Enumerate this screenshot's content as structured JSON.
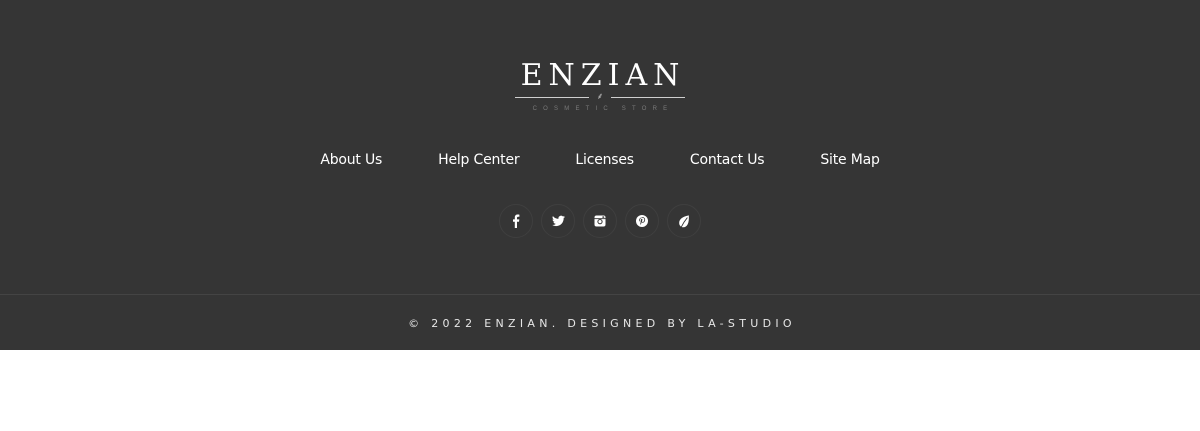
{
  "logo": {
    "name": "ENZIAN",
    "tagline": "COSMETIC STORE"
  },
  "nav": {
    "items": [
      {
        "label": "About Us"
      },
      {
        "label": "Help Center"
      },
      {
        "label": "Licenses"
      },
      {
        "label": "Contact Us"
      },
      {
        "label": "Site Map"
      }
    ]
  },
  "social": {
    "icons": [
      "facebook-icon",
      "twitter-icon",
      "instagram-icon",
      "pinterest-icon",
      "leaf-icon"
    ]
  },
  "copyright": {
    "text": "© 2022 ENZIAN. DESIGNED BY LA-STUDIO"
  },
  "colors": {
    "footer_background": "#353535",
    "text": "#ffffff",
    "page_background": "#ffffff"
  }
}
